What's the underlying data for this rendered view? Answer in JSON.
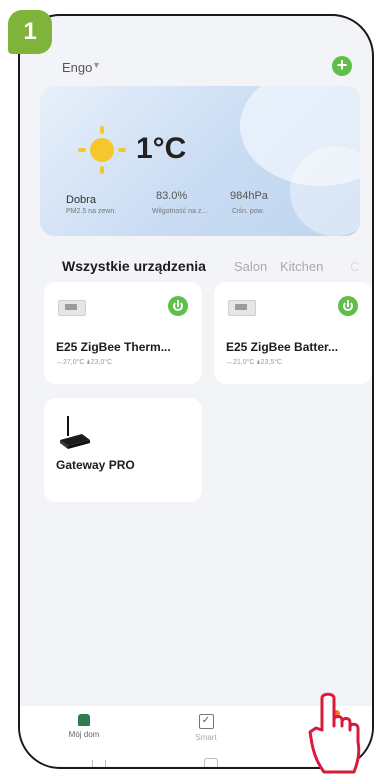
{
  "step_badge": "1",
  "header": {
    "home_name": "Engo"
  },
  "weather": {
    "temperature": "1°C",
    "air_quality": "Dobra",
    "air_quality_sub": "PM2.5 na zewn.",
    "humidity": "83.0%",
    "humidity_sub": "Wilgotność na z...",
    "pressure": "984hPa",
    "pressure_sub": "Ciśn. pow."
  },
  "tabs": {
    "active": "Wszystkie urządzenia",
    "items": [
      "Salon",
      "Kitchen",
      "C"
    ],
    "more": "···"
  },
  "devices": [
    {
      "name": "E25 ZigBee Therm...",
      "status": "↔27,0°C  🌢23,0°C"
    },
    {
      "name": "E25 ZigBee Batter...",
      "status": "↔21,0°C  🌢23,5°C"
    },
    {
      "name": "Gateway PRO"
    }
  ],
  "nav": {
    "home": "Mój dom",
    "smart": "Smart"
  },
  "colors": {
    "accent_green": "#5fbf4a",
    "badge_green": "#7fb43a",
    "home_icon": "#2f7d4f",
    "notification_dot": "#f07a2a"
  }
}
